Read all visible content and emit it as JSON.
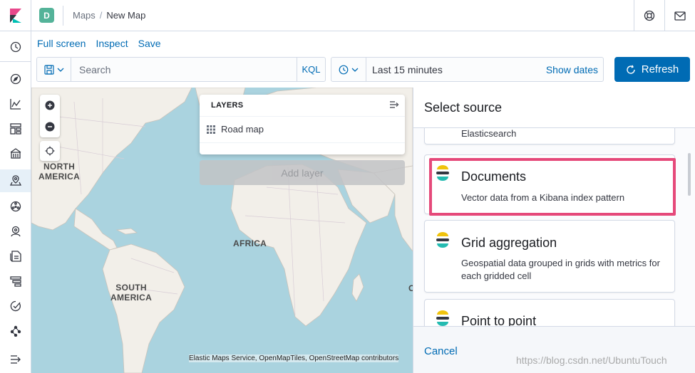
{
  "header": {
    "space_initial": "D",
    "breadcrumbs": [
      "Maps",
      "New Map"
    ],
    "icons": [
      "kibana-logo-icon",
      "help-icon",
      "mail-icon"
    ]
  },
  "sidenav": {
    "items": [
      "recent-icon",
      "discover-icon",
      "visualize-icon",
      "dashboard-icon",
      "canvas-icon",
      "maps-icon",
      "ml-icon",
      "infrastructure-icon",
      "logs-icon",
      "apm-icon",
      "uptime-icon",
      "graph-icon",
      "collapse-icon"
    ],
    "active": "maps-icon"
  },
  "menu": {
    "full_screen": "Full screen",
    "inspect": "Inspect",
    "save": "Save"
  },
  "query": {
    "placeholder": "Search",
    "language": "KQL"
  },
  "time": {
    "range": "Last 15 minutes",
    "show_dates": "Show dates"
  },
  "refresh": {
    "label": "Refresh"
  },
  "map": {
    "labels": {
      "north_america": "NORTH\nAMERICA",
      "south_america": "SOUTH\nAMERICA",
      "africa": "AFRICA",
      "edge": "C"
    },
    "attribution": "Elastic Maps Service, OpenMapTiles, OpenStreetMap contributors",
    "ocean_color": "#aad3df",
    "land_color": "#f2efe9"
  },
  "layers": {
    "title": "LAYERS",
    "items": [
      {
        "name": "Road map"
      }
    ],
    "add_layer": "Add layer"
  },
  "flyout": {
    "title": "Select source",
    "sources": [
      {
        "title": "",
        "description": "Elasticsearch"
      },
      {
        "title": "Documents",
        "description": "Vector data from a Kibana index pattern"
      },
      {
        "title": "Grid aggregation",
        "description": "Geospatial data grouped in grids with metrics for each gridded cell"
      },
      {
        "title": "Point to point",
        "description": ""
      }
    ],
    "cancel": "Cancel",
    "highlight_color": "#e5497a"
  },
  "watermark": "https://blog.csdn.net/UbuntuTouch"
}
